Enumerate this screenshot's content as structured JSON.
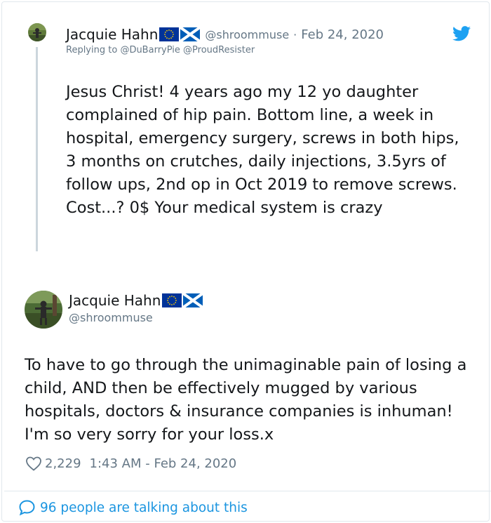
{
  "parent_tweet": {
    "author_name": "Jacquie Hahn",
    "handle": "@shroommuse",
    "separator": "·",
    "date": "Feb 24, 2020",
    "reply_prefix": "Replying to",
    "reply_mentions": "@DuBarryPie @ProudResister",
    "text": "Jesus Christ! 4 years ago my 12 yo daughter complained of hip pain. Bottom line, a week in hospital, emergency surgery, screws in both hips, 3 months on crutches, daily injections, 3.5yrs of follow ups, 2nd op in Oct 2019 to remove screws. Cost...? 0$ Your medical system is crazy",
    "icons": [
      "avatar",
      "eu-flag-icon",
      "scotland-flag-icon",
      "twitter-bird-icon"
    ]
  },
  "reply_tweet": {
    "author_name": "Jacquie Hahn",
    "handle": "@shroommuse",
    "text": "To have to go through the unimaginable pain of losing a child, AND then be effectively mugged by various hospitals, doctors & insurance companies is inhuman! I'm so very sorry for your loss.x",
    "likes": "2,229",
    "timestamp": "1:43 AM - Feb 24, 2020",
    "icons": [
      "avatar",
      "eu-flag-icon",
      "scotland-flag-icon",
      "heart-icon"
    ]
  },
  "footer": {
    "talking_label": "96 people are talking about this",
    "icon": "speech-bubble-icon"
  },
  "colors": {
    "text": "#14171a",
    "secondary": "#657786",
    "link": "#1b95e0",
    "twitter_blue": "#1da1f2",
    "border": "#e1e8ed",
    "thread_line": "#ccd6dd",
    "eu_blue": "#003399",
    "eu_star": "#ffcc00",
    "scotland_blue": "#005eb8"
  }
}
